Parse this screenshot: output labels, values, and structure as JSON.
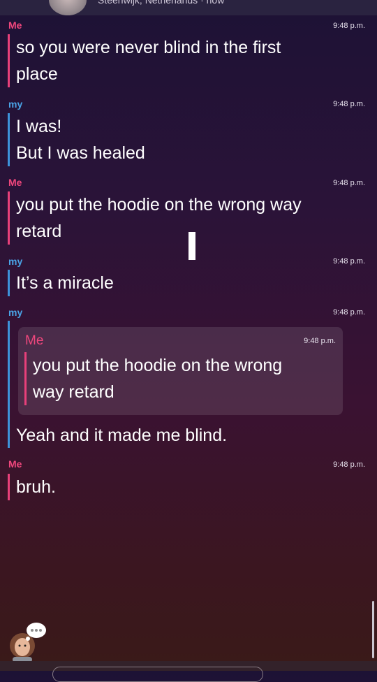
{
  "header": {
    "location_text": "Steenwijk, Netherlands · now"
  },
  "messages": [
    {
      "sender": "Me",
      "time": "9:48 p.m.",
      "text": "so you were never blind in the first\nplace"
    },
    {
      "sender": "my",
      "time": "9:48 p.m.",
      "text": "I was!\nBut I was healed"
    },
    {
      "sender": "Me",
      "time": "9:48 p.m.",
      "text": "you put the hoodie on the wrong way\nretard"
    },
    {
      "sender": "my",
      "time": "9:48 p.m.",
      "text": "It’s a miracle"
    },
    {
      "sender": "my",
      "time": "9:48 p.m.",
      "quote": {
        "sender": "Me",
        "time": "9:48 p.m.",
        "text": "you put the hoodie on the wrong\nway retard"
      },
      "text": "Yeah and it made me blind."
    },
    {
      "sender": "Me",
      "time": "9:48 p.m.",
      "text": "bruh."
    }
  ],
  "colors": {
    "me": "#f0477d",
    "my": "#4aa3e6",
    "bar_me": "#e8407a",
    "bar_my": "#3d93da"
  },
  "icons": {
    "typing": "typing-bubble-icon",
    "friend_avatar": "bitmoji-avatar"
  }
}
